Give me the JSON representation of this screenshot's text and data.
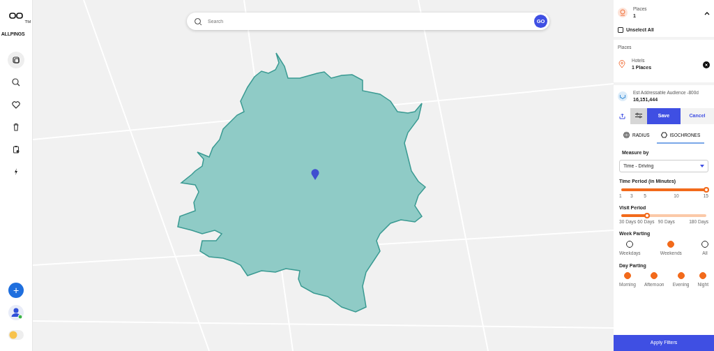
{
  "logo": {
    "text": "ALLPINGS",
    "mark": "TM"
  },
  "sidebar": {
    "items": [
      {
        "kind": "layers",
        "selected": true
      },
      {
        "kind": "search",
        "selected": false
      },
      {
        "kind": "heart",
        "selected": false
      },
      {
        "kind": "trash",
        "selected": false
      },
      {
        "kind": "clipboard",
        "selected": false
      },
      {
        "kind": "bolt",
        "selected": false
      }
    ],
    "add_button": "+"
  },
  "search": {
    "placeholder": "Search",
    "button": "GO"
  },
  "panel": {
    "places_header": {
      "label": "Places",
      "value": "1",
      "expanded": true
    },
    "unselect_all": {
      "label": "Unselect All",
      "checked": false
    },
    "places_section": {
      "label": "Places",
      "items": [
        {
          "category": "Hotels",
          "count": "1 Places"
        }
      ]
    },
    "audience": {
      "label": "Est Addressable Audience -800d",
      "value": "16,151,444"
    },
    "actions": {
      "save": "Save",
      "cancel": "Cancel"
    },
    "tabs": [
      {
        "label": "RADIUS",
        "kind": "radius",
        "selected": false
      },
      {
        "label": "ISOCHRONES",
        "kind": "hexagon",
        "selected": true
      }
    ],
    "measure_by": {
      "label": "Measure by",
      "value": "Time - Driving"
    },
    "time_period": {
      "label": "Time Period (in Minutes)",
      "level": 1,
      "ticks": [
        "1",
        "3",
        "5",
        "10",
        "15"
      ]
    },
    "visit_period": {
      "label": "Visit Period",
      "level": 0.3,
      "ticks": [
        "30 Days",
        "60 Days",
        "90 Days",
        "180 Days"
      ]
    },
    "week_parting": {
      "label": "Week Parting",
      "options": [
        {
          "label": "Weekdays",
          "selected": false
        },
        {
          "label": "Weekends",
          "selected": true
        },
        {
          "label": "All",
          "selected": false
        }
      ]
    },
    "day_parting": {
      "label": "Day Parting",
      "options": [
        {
          "label": "Morning",
          "selected": true
        },
        {
          "label": "Afternoon",
          "selected": true
        },
        {
          "label": "Evening",
          "selected": true
        },
        {
          "label": "Night",
          "selected": true
        }
      ]
    },
    "apply": "Apply Filters"
  }
}
